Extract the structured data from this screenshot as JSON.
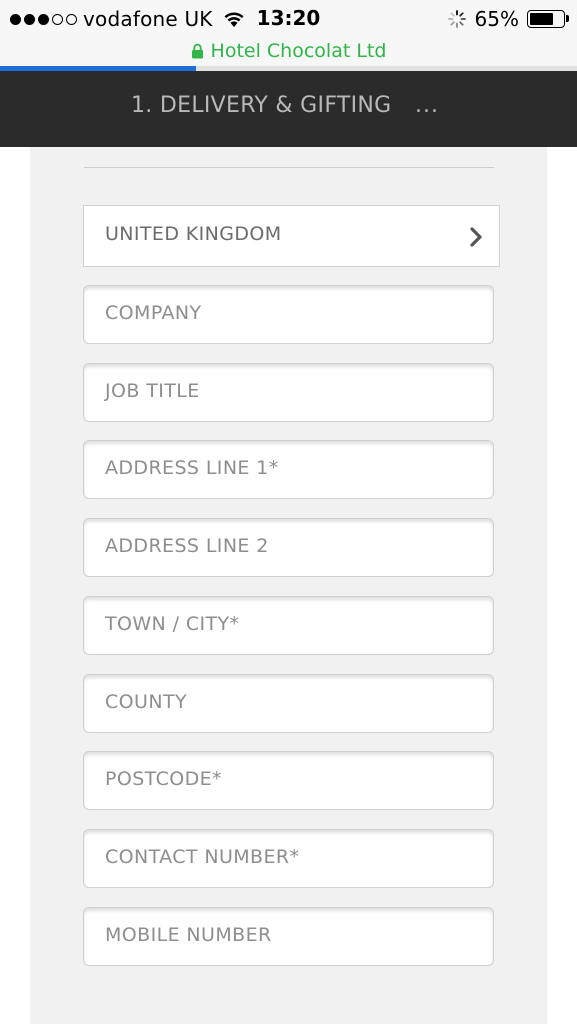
{
  "status_bar": {
    "signal_bars": 3,
    "signal_total": 5,
    "carrier": "vodafone UK",
    "time": "13:20",
    "battery_percent": "65%",
    "battery_level": 0.65
  },
  "browser": {
    "url_display": "Hotel Chocolat Ltd",
    "page_load_progress": 0.34,
    "secure": true
  },
  "header": {
    "step_title": "1. DELIVERY & GIFTING",
    "more": "..."
  },
  "form": {
    "country": {
      "value": "UNITED KINGDOM",
      "icon": "chevron-right-icon"
    },
    "fields": [
      {
        "name": "company-field",
        "placeholder": "COMPANY"
      },
      {
        "name": "job-title-field",
        "placeholder": "JOB TITLE"
      },
      {
        "name": "address-line-1-field",
        "placeholder": "ADDRESS LINE 1*"
      },
      {
        "name": "address-line-2-field",
        "placeholder": "ADDRESS LINE 2"
      },
      {
        "name": "town-city-field",
        "placeholder": "TOWN / CITY*"
      },
      {
        "name": "county-field",
        "placeholder": "COUNTY"
      },
      {
        "name": "postcode-field",
        "placeholder": "POSTCODE*"
      },
      {
        "name": "contact-number-field",
        "placeholder": "CONTACT NUMBER*"
      },
      {
        "name": "mobile-number-field",
        "placeholder": "MOBILE NUMBER"
      }
    ]
  },
  "colors": {
    "header_bg": "#2b2b2b",
    "url_green": "#2fb548",
    "progress_blue": "#1d6ed6",
    "panel_bg": "#f1f1f1"
  }
}
